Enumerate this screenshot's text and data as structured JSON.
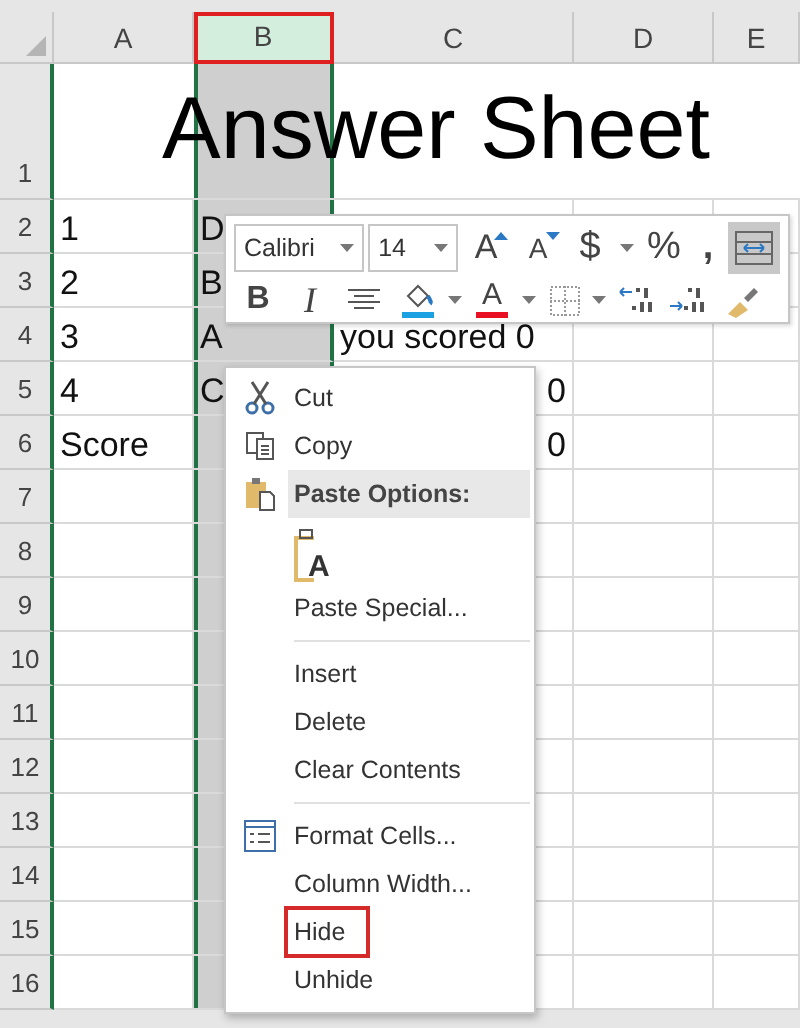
{
  "sheet": {
    "columns": [
      {
        "label": "A",
        "selected": false,
        "outlined": false
      },
      {
        "label": "B",
        "selected": true,
        "outlined": true
      },
      {
        "label": "C",
        "selected": false,
        "outlined": false
      },
      {
        "label": "D",
        "selected": false,
        "outlined": false
      },
      {
        "label": "E",
        "selected": false,
        "outlined": false
      }
    ],
    "title": "Answer Sheet",
    "rows": [
      {
        "label": "1",
        "cells": {}
      },
      {
        "label": "2",
        "cells": {
          "a": {
            "text": "1",
            "numeric": false
          },
          "b": {
            "text": "D",
            "numeric": false
          }
        }
      },
      {
        "label": "3",
        "cells": {
          "a": {
            "text": "2",
            "numeric": false
          },
          "b": {
            "text": "B",
            "numeric": false
          }
        }
      },
      {
        "label": "4",
        "cells": {
          "a": {
            "text": "3",
            "numeric": false
          },
          "b": {
            "text": "A",
            "numeric": false
          },
          "c": {
            "text": "you scored 0",
            "numeric": false
          }
        }
      },
      {
        "label": "5",
        "cells": {
          "a": {
            "text": "4",
            "numeric": false
          },
          "b": {
            "text": "C",
            "numeric": false
          },
          "c": {
            "text": "0",
            "numeric": true
          }
        }
      },
      {
        "label": "6",
        "cells": {
          "a": {
            "text": "Score",
            "numeric": false
          },
          "c": {
            "text": "0",
            "numeric": true
          }
        }
      },
      {
        "label": "7",
        "cells": {}
      },
      {
        "label": "8",
        "cells": {}
      },
      {
        "label": "9",
        "cells": {}
      },
      {
        "label": "10",
        "cells": {}
      },
      {
        "label": "11",
        "cells": {}
      },
      {
        "label": "12",
        "cells": {}
      },
      {
        "label": "13",
        "cells": {}
      },
      {
        "label": "14",
        "cells": {}
      },
      {
        "label": "15",
        "cells": {}
      },
      {
        "label": "16",
        "cells": {}
      }
    ]
  },
  "mini_toolbar": {
    "font": "Calibri",
    "size": "14",
    "upper_buttons": [
      {
        "kind": "grow-font",
        "label": "A"
      },
      {
        "kind": "shrink-font",
        "label": "A"
      },
      {
        "kind": "currency",
        "label": "$"
      },
      {
        "kind": "dropdown"
      },
      {
        "kind": "percent",
        "label": "%"
      },
      {
        "kind": "comma",
        "label": ","
      },
      {
        "kind": "wrap",
        "selected": true
      }
    ],
    "lower_buttons": [
      {
        "kind": "bold",
        "label": "B"
      },
      {
        "kind": "italic",
        "label": "I"
      },
      {
        "kind": "center"
      },
      {
        "kind": "fill-color",
        "color": "#1ba1e2"
      },
      {
        "kind": "dropdown"
      },
      {
        "kind": "font-color",
        "label": "A",
        "color": "#e81123"
      },
      {
        "kind": "dropdown"
      },
      {
        "kind": "borders"
      },
      {
        "kind": "dropdown"
      },
      {
        "kind": "increase-decimal"
      },
      {
        "kind": "decrease-decimal"
      },
      {
        "kind": "format-painter"
      }
    ]
  },
  "context_menu": [
    {
      "kind": "cut",
      "label": "Cut",
      "outlined": false
    },
    {
      "kind": "copy",
      "label": "Copy",
      "outlined": false
    },
    {
      "kind": "paste-header",
      "label": "Paste Options:"
    },
    {
      "kind": "paste-button",
      "label": "A"
    },
    {
      "kind": "item",
      "label": "Paste Special...",
      "outlined": false
    },
    {
      "kind": "separator"
    },
    {
      "kind": "item",
      "label": "Insert",
      "outlined": false
    },
    {
      "kind": "item",
      "label": "Delete",
      "outlined": false
    },
    {
      "kind": "item",
      "label": "Clear Contents",
      "outlined": false
    },
    {
      "kind": "separator"
    },
    {
      "kind": "format",
      "label": "Format Cells...",
      "outlined": false
    },
    {
      "kind": "item",
      "label": "Column Width...",
      "outlined": false
    },
    {
      "kind": "item",
      "label": "Hide",
      "outlined": true
    },
    {
      "kind": "item",
      "label": "Unhide",
      "outlined": false
    }
  ]
}
